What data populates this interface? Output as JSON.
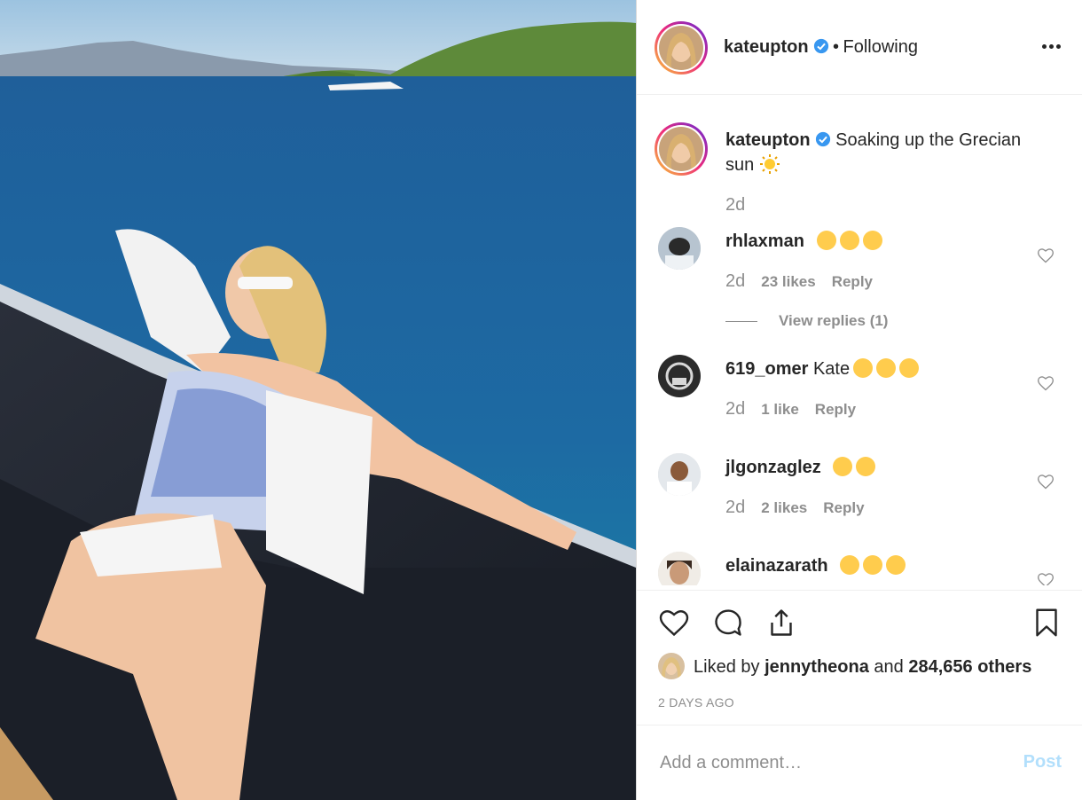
{
  "post": {
    "username": "kateupton",
    "verified": true,
    "separator": "•",
    "following_label": "Following",
    "caption": "Soaking up the Grecian sun",
    "caption_emoji": "sun",
    "caption_time": "2d"
  },
  "comments": [
    {
      "username": "rhlaxman",
      "text": "",
      "emojis": [
        "smiling-face",
        "smiling-face",
        "smiling-face"
      ],
      "time": "2d",
      "likes": "23 likes",
      "reply": "Reply",
      "view_replies": "View replies (1)"
    },
    {
      "username": "619_omer",
      "text": "Kate",
      "emojis": [
        "heart-eyes",
        "grinning",
        "grinning"
      ],
      "time": "2d",
      "likes": "1 like",
      "reply": "Reply"
    },
    {
      "username": "jlgonzaglez",
      "text": "",
      "emojis": [
        "heart-eyes",
        "heart-eyes"
      ],
      "time": "2d",
      "likes": "2 likes",
      "reply": "Reply"
    },
    {
      "username": "elainazarath",
      "text": "",
      "emojis": [
        "clapping",
        "clapping",
        "clapping"
      ]
    }
  ],
  "likes": {
    "prefix": "Liked by",
    "user": "jennytheona",
    "and": "and",
    "others": "284,656 others"
  },
  "timestamp": "2 DAYS AGO",
  "add_comment": {
    "placeholder": "Add a comment…",
    "post_label": "Post"
  },
  "colors": {
    "verified": "#3897f0",
    "post_disabled": "#b2dffc",
    "muted": "#8e8e8e"
  }
}
